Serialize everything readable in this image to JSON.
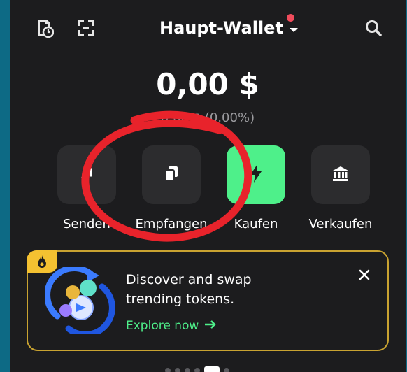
{
  "header": {
    "wallet_name": "Haupt-Wallet",
    "icons": [
      "history-icon",
      "scan-icon",
      "search-icon"
    ]
  },
  "balance": {
    "amount": "0,00 $",
    "change": "0,00 $ (0.00%)"
  },
  "actions": [
    {
      "label": "Senden",
      "icon": "send-arrow-icon"
    },
    {
      "label": "Empfangen",
      "icon": "receive-copy-icon"
    },
    {
      "label": "Kaufen",
      "icon": "lightning-icon"
    },
    {
      "label": "Verkaufen",
      "icon": "bank-icon"
    }
  ],
  "promo": {
    "text": "Discover and swap trending tokens.",
    "link": "Explore now",
    "badge_icon": "fire-icon"
  },
  "pager": {
    "count": 6,
    "active": 4
  },
  "colors": {
    "background": "#0d6a85",
    "surface": "#1c1c1e",
    "button": "#2c2c2e",
    "accent_green": "#4ef08a",
    "accent_yellow": "#f4c131",
    "annotation_red": "#e8232b"
  }
}
